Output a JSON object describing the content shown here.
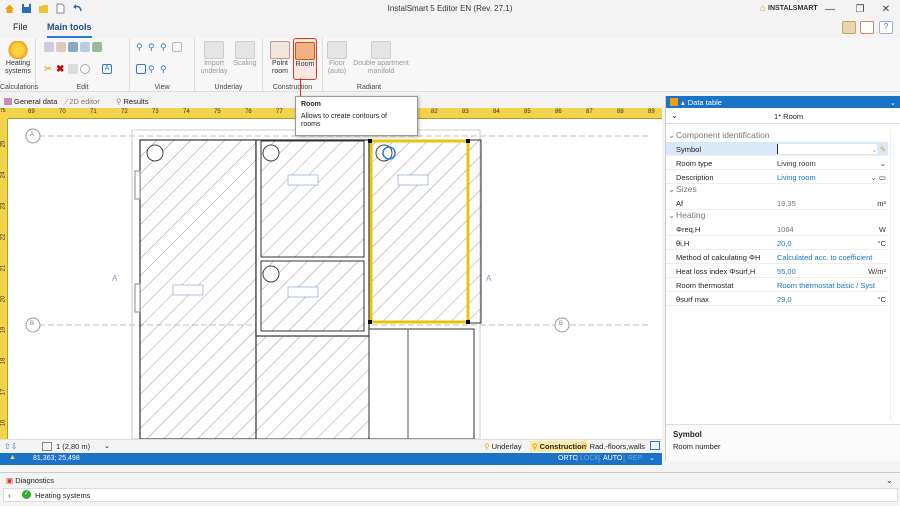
{
  "window": {
    "title": "InstalSmart 5 Editor EN (Rev. 27.1)",
    "brand": "INSTALSMART"
  },
  "menu": {
    "file": "File",
    "main_tools": "Main tools"
  },
  "ribbon": {
    "heating_systems": "Heating systems",
    "groups": {
      "calculations": "Calculations",
      "edit": "Edit",
      "view": "View",
      "underlay": "Underlay",
      "construction": "Construction",
      "radiant": "Radiant"
    },
    "import_underlay": "Import underlay",
    "scaling": "Scaling",
    "point_room": "Point room",
    "room": "Room",
    "floor_auto": "Floor (auto)",
    "double_apartment_manifold": "Double apartment manifold"
  },
  "tooltip": {
    "title": "Room",
    "description": "Allows to create contours of rooms"
  },
  "tabs": {
    "general_data": "General data",
    "editor_2d": "2D editor",
    "results": "Results"
  },
  "ruler": {
    "h_ticks": [
      "69",
      "70",
      "71",
      "72",
      "73",
      "74",
      "75",
      "76",
      "77",
      "78",
      "",
      "",
      "",
      "82",
      "83",
      "84",
      "85",
      "86",
      "87",
      "88",
      "89"
    ],
    "v_ticks": [
      "25",
      "24",
      "23",
      "22",
      "21",
      "20",
      "19",
      "18",
      "17",
      "16"
    ],
    "corner": "75"
  },
  "canvas": {
    "axis_a_left": "A",
    "axis_a_right": "A",
    "axis_a_top": "A",
    "axis_b_left": "B",
    "axis_b_right": "B"
  },
  "status": {
    "level": "1 (2,80 m)",
    "underlay": "Underlay",
    "construction": "Construction",
    "rad_floors": "Rad.-floors,walls",
    "coords": "81,363; 25,498",
    "orto": "ORTO",
    "lock": "LOCK",
    "auto": "AUTO",
    "rep": "REP"
  },
  "panel": {
    "header": "Data table",
    "room_title": "1* Room",
    "sections": {
      "component": "Component identification",
      "sizes": "Sizes",
      "heating": "Heating"
    },
    "rows": [
      {
        "label": "Symbol",
        "value": "",
        "unit": ""
      },
      {
        "label": "Room type",
        "value": "Living room",
        "unit": ""
      },
      {
        "label": "Description",
        "value": "Living room",
        "unit": ""
      },
      {
        "label": "Af",
        "value": "19,35",
        "unit": "m²"
      },
      {
        "label": "Φreq,H",
        "value": "1064",
        "unit": "W"
      },
      {
        "label": "θi,H",
        "value": "20,0",
        "unit": "°C"
      },
      {
        "label": "Method of calculating ΦH",
        "value": "Calculated acc. to coefficient",
        "unit": ""
      },
      {
        "label": "Heat loss index Φsurf,H",
        "value": "55,00",
        "unit": "W/m²"
      },
      {
        "label": "Room thermostat",
        "value": "Room thermostat basic / Syst",
        "unit": ""
      },
      {
        "label": "θsurf max",
        "value": "29,0",
        "unit": "°C"
      }
    ],
    "help_title": "Symbol",
    "help_text": "Room number"
  },
  "bottom": {
    "diagnostics": "Diagnostics",
    "heating_systems": "Heating systems"
  }
}
